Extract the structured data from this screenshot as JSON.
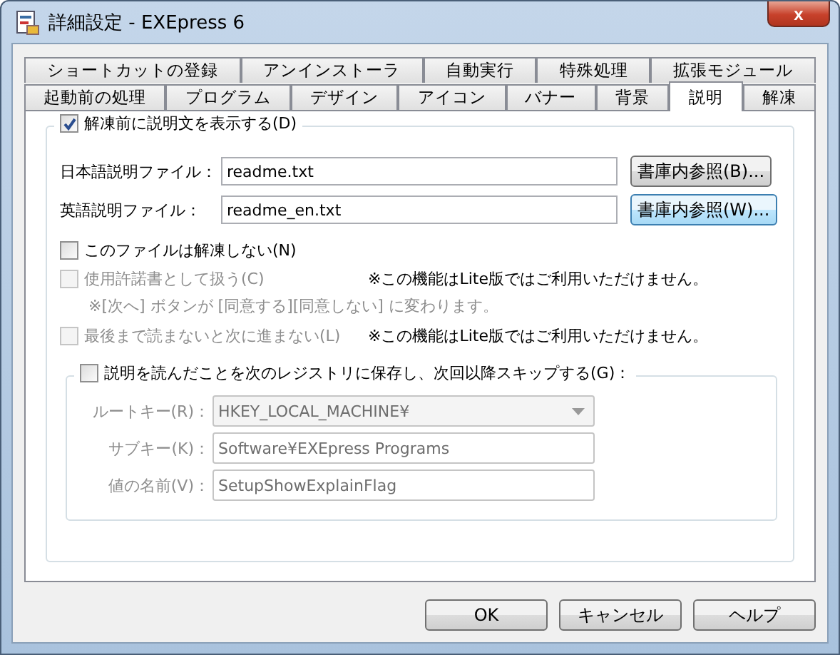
{
  "window": {
    "title": "詳細設定 - EXEpress 6",
    "close": "x"
  },
  "tab_rows": [
    [
      {
        "label": "ショートカットの登録",
        "selected": false
      },
      {
        "label": "アンインストーラ",
        "selected": false
      },
      {
        "label": "自動実行",
        "selected": false
      },
      {
        "label": "特殊処理",
        "selected": false
      },
      {
        "label": "拡張モジュール",
        "selected": false
      }
    ],
    [
      {
        "label": "起動前の処理",
        "selected": false
      },
      {
        "label": "プログラム",
        "selected": false
      },
      {
        "label": "デザイン",
        "selected": false
      },
      {
        "label": "アイコン",
        "selected": false
      },
      {
        "label": "バナー",
        "selected": false
      },
      {
        "label": "背景",
        "selected": false
      },
      {
        "label": "説明",
        "selected": true
      },
      {
        "label": "解凍",
        "selected": false
      }
    ]
  ],
  "show_explanation": {
    "label": "解凍前に説明文を表示する(D)",
    "checked": true
  },
  "files": [
    {
      "label": "日本語説明ファイル：",
      "value": "readme.txt",
      "button": "書庫内参照(B)...",
      "focused": false
    },
    {
      "label": "英語説明ファイル：",
      "value": "readme_en.txt",
      "button": "書庫内参照(W)...",
      "focused": true
    }
  ],
  "options": [
    {
      "label": "このファイルは解凍しない(N)",
      "checked": false,
      "disabled": false
    },
    {
      "label": "使用許諾書として扱う(C)",
      "checked": false,
      "disabled": true,
      "note": "※この機能はLite版ではご利用いただけません。",
      "sub_note": "※[次へ] ボタンが [同意する][同意しない] に変わります。"
    },
    {
      "label": "最後まで読まないと次に進まない(L)",
      "checked": false,
      "disabled": true,
      "note": "※この機能はLite版ではご利用いただけません。"
    }
  ],
  "registry": {
    "label": "説明を読んだことを次のレジストリに保存し、次回以降スキップする(G)：",
    "checked": false,
    "fields": [
      {
        "kind": "dropdown",
        "label": "ルートキー(R)：",
        "value": "HKEY_LOCAL_MACHINE¥",
        "disabled": true
      },
      {
        "kind": "text",
        "label": "サブキー(K)：",
        "value": "Software¥EXEpress Programs",
        "disabled": true
      },
      {
        "kind": "text",
        "label": "値の名前(V)：",
        "value": "SetupShowExplainFlag",
        "disabled": true
      }
    ]
  },
  "buttons": [
    "OK",
    "キャンセル",
    "ヘルプ"
  ]
}
